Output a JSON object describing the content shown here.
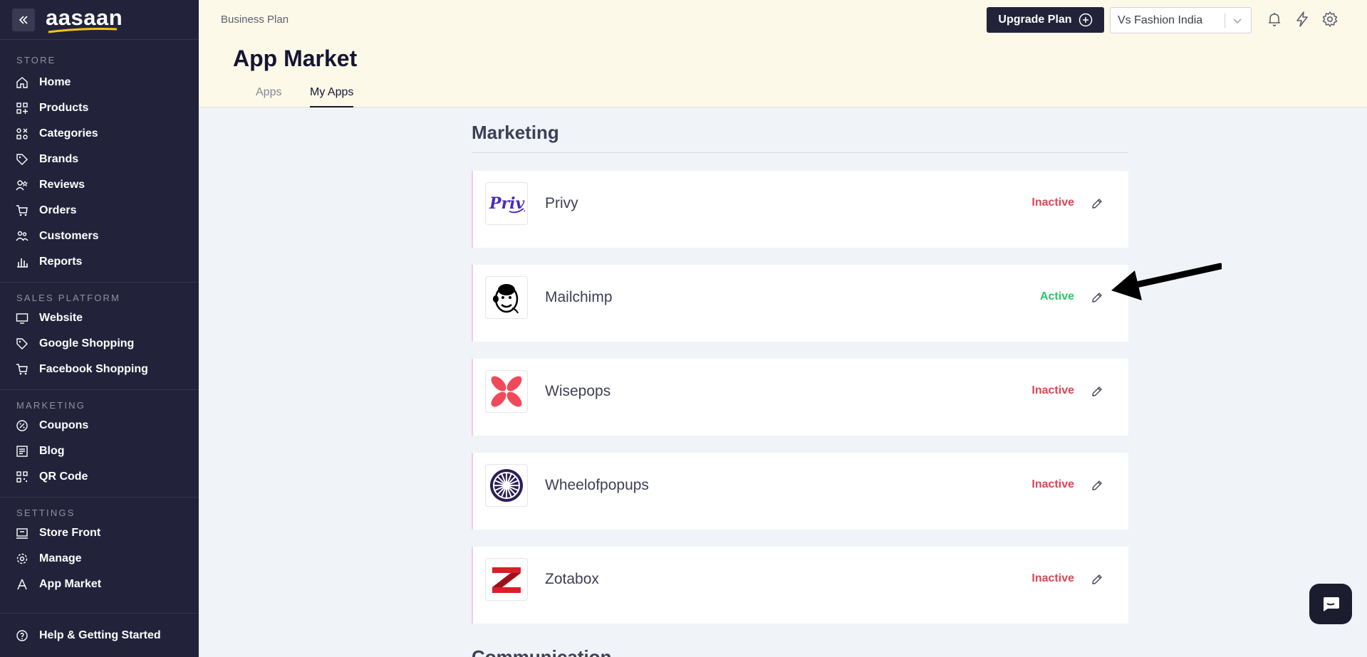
{
  "sidebar": {
    "logo": "aasaan",
    "sections": [
      {
        "title": "STORE",
        "items": [
          "Home",
          "Products",
          "Categories",
          "Brands",
          "Reviews",
          "Orders",
          "Customers",
          "Reports"
        ]
      },
      {
        "title": "SALES PLATFORM",
        "items": [
          "Website",
          "Google Shopping",
          "Facebook Shopping"
        ]
      },
      {
        "title": "MARKETING",
        "items": [
          "Coupons",
          "Blog",
          "QR Code"
        ]
      },
      {
        "title": "SETTINGS",
        "items": [
          "Store Front",
          "Manage",
          "App Market"
        ]
      }
    ],
    "help": "Help & Getting Started"
  },
  "header": {
    "plan": "Business Plan",
    "title": "App Market",
    "tabs": [
      "Apps",
      "My Apps"
    ],
    "active_tab": "My Apps",
    "upgrade_label": "Upgrade Plan",
    "store_name": "Vs Fashion India"
  },
  "main": {
    "section_title": "Marketing",
    "apps": [
      {
        "name": "Privy",
        "status": "Inactive"
      },
      {
        "name": "Mailchimp",
        "status": "Active"
      },
      {
        "name": "Wisepops",
        "status": "Inactive"
      },
      {
        "name": "Wheelofpopups",
        "status": "Inactive"
      },
      {
        "name": "Zotabox",
        "status": "Inactive"
      }
    ],
    "next_section_title": "Communication"
  },
  "colors": {
    "sidebar_bg": "#22233a",
    "header_bg": "#fdf9e9",
    "active": "#2ec56c",
    "inactive": "#dc4655"
  }
}
